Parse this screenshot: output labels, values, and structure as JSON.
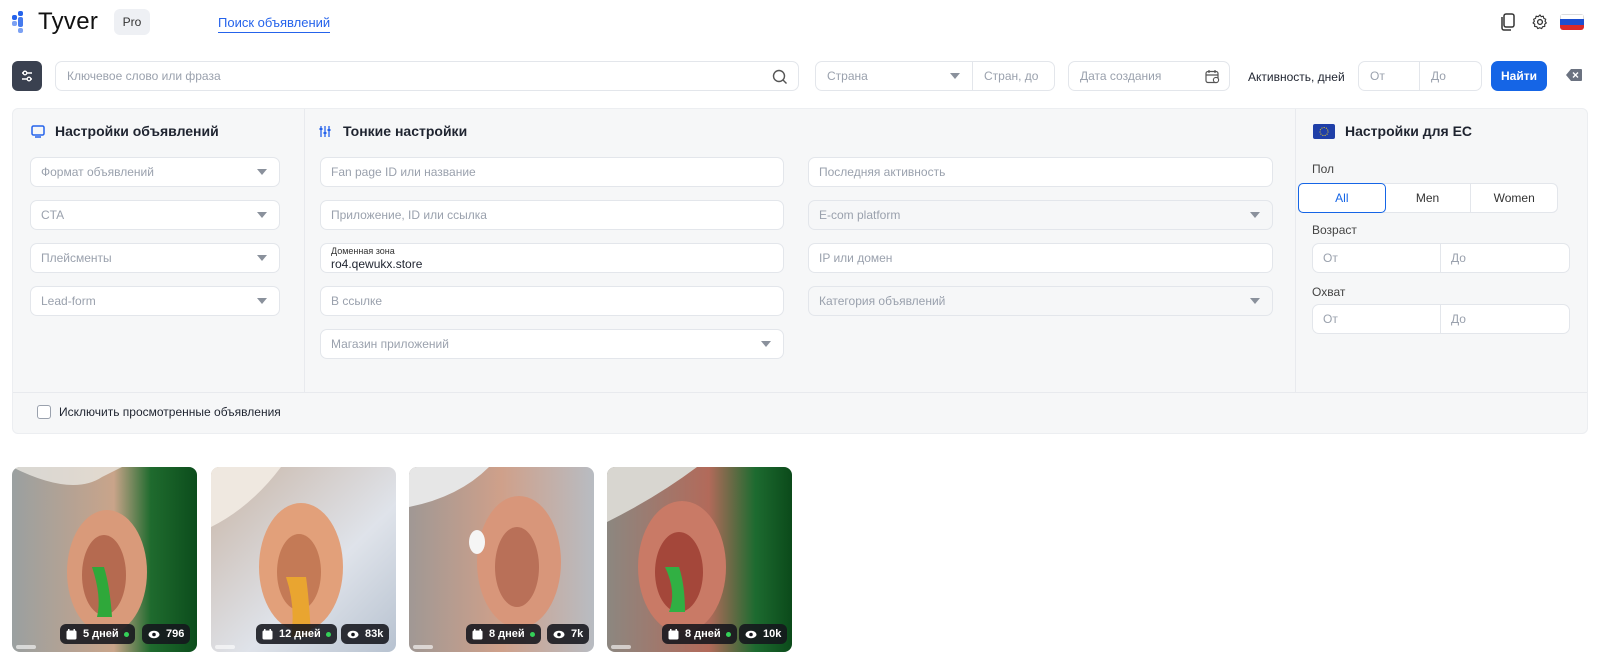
{
  "header": {
    "logo_text": "Tyver",
    "pro_badge": "Pro",
    "nav_link": "Поиск объявлений",
    "brand_color": "#2563eb"
  },
  "search": {
    "keyword_placeholder": "Ключевое слово или фраза",
    "country_placeholder": "Страна",
    "country_exclude_placeholder": "Стран, до",
    "date_placeholder": "Дата создания",
    "activity_label": "Активность, дней",
    "activity_from_placeholder": "От",
    "activity_to_placeholder": "До",
    "find_button": "Найти",
    "accent_color": "#1565e6"
  },
  "ad_settings": {
    "title": "Настройки объявлений",
    "fields": [
      {
        "placeholder": "Формат объявлений",
        "type": "select"
      },
      {
        "placeholder": "CTA",
        "type": "select"
      },
      {
        "placeholder": "Плейсменты",
        "type": "select"
      },
      {
        "placeholder": "Lead-form",
        "type": "select"
      }
    ]
  },
  "fine_settings": {
    "title": "Тонкие настройки",
    "left_fields": [
      {
        "placeholder": "Fan page ID или название"
      },
      {
        "placeholder": "Приложение, ID или ссылка"
      },
      {
        "label": "Доменная зона",
        "value": "ro4.qewukx.store"
      },
      {
        "placeholder": "В ссылке"
      },
      {
        "placeholder": "Магазин приложений",
        "type": "select"
      }
    ],
    "right_fields": [
      {
        "placeholder": "Последняя активность"
      },
      {
        "placeholder": "E-com platform",
        "type": "select"
      },
      {
        "placeholder": "IP или домен"
      },
      {
        "placeholder": "Категория объявлений",
        "type": "select"
      }
    ]
  },
  "eu_settings": {
    "title": "Настройки для ЕС",
    "gender_label": "Пол",
    "gender_options": [
      "All",
      "Men",
      "Women"
    ],
    "gender_selected": "All",
    "age_label": "Возраст",
    "age_from": "От",
    "age_to": "До",
    "reach_label": "Охват",
    "reach_from": "От",
    "reach_to": "До"
  },
  "exclude_viewed": {
    "label": "Исключить просмотренные объявления",
    "checked": false
  },
  "cards": [
    {
      "days": "5 дней",
      "views": "796",
      "active": true
    },
    {
      "days": "12 дней",
      "views": "83k",
      "active": true
    },
    {
      "days": "8 дней",
      "views": "7k",
      "active": true
    },
    {
      "days": "8 дней",
      "views": "10k",
      "active": true
    }
  ]
}
